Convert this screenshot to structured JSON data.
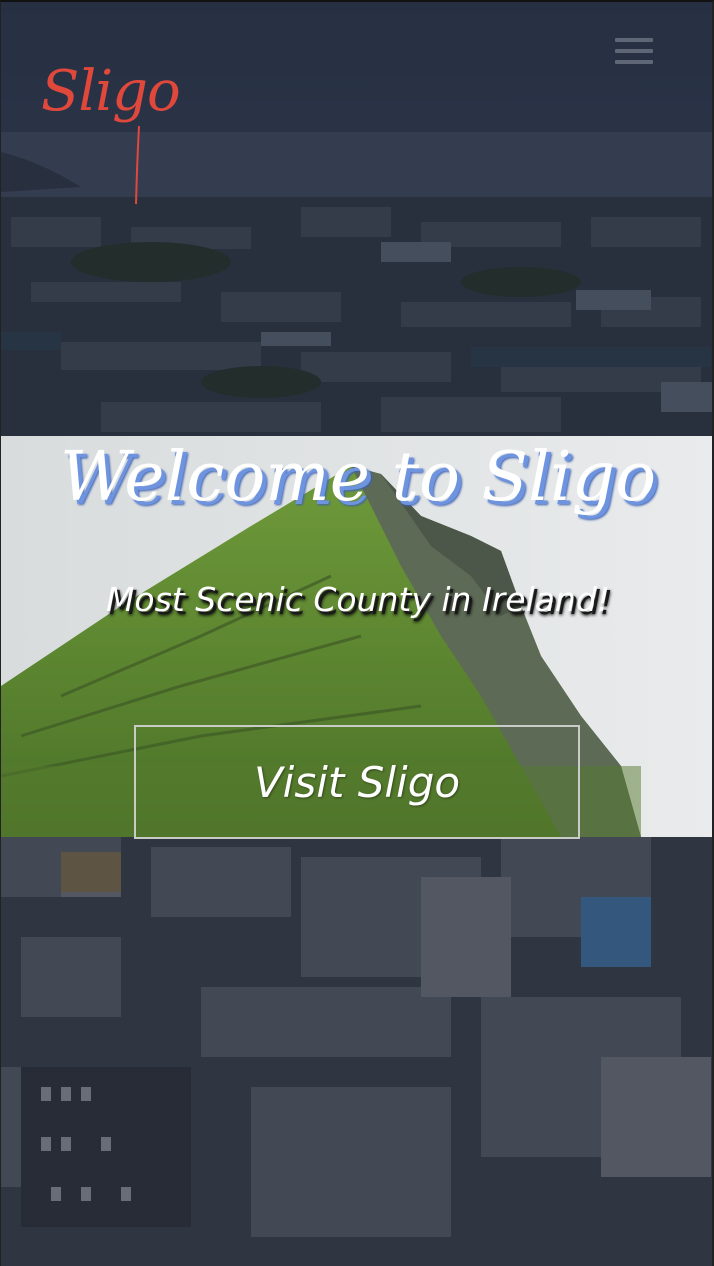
{
  "header": {
    "logo_text": "Sligo",
    "menu_icon": "hamburger-menu-icon"
  },
  "hero": {
    "title": "Welcome to Sligo",
    "subtitle": "Most Scenic County in Ireland!",
    "cta_label": "Visit Sligo"
  },
  "colors": {
    "logo": "#e0483c",
    "title_shadow": "#6e94e0",
    "overlay": "#1b2233",
    "button_border": "#c9cbc6"
  }
}
